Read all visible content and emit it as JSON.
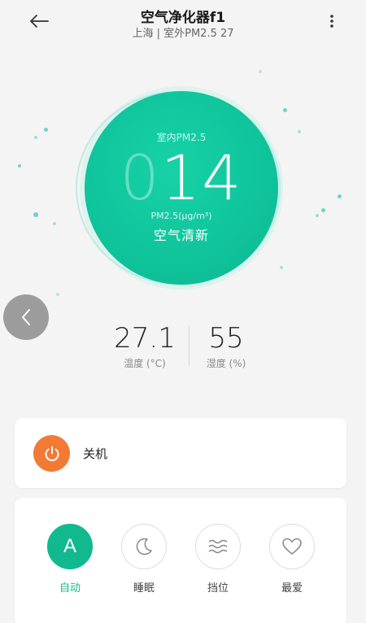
{
  "header": {
    "title": "空气净化器f1",
    "subtitle": "上海 | 室外PM2.5 27"
  },
  "reading": {
    "label": "室内PM2.5",
    "leading_digit": "0",
    "value": "14",
    "unit": "PM2.5(μg/m³)",
    "status": "空气清新"
  },
  "stats": {
    "temperature": {
      "value": "27.1",
      "label": "温度 (°C)"
    },
    "humidity": {
      "value": "55",
      "label": "湿度 (%)"
    }
  },
  "power": {
    "label": "关机"
  },
  "modes": [
    {
      "label": "自动",
      "icon_text": "A",
      "icon": "auto-icon",
      "active": true
    },
    {
      "label": "睡眠",
      "icon": "moon-icon",
      "active": false
    },
    {
      "label": "挡位",
      "icon": "waves-icon",
      "active": false
    },
    {
      "label": "最爱",
      "icon": "heart-icon",
      "active": false
    }
  ],
  "colors": {
    "accent": "#12b98f",
    "power": "#f27a35"
  }
}
